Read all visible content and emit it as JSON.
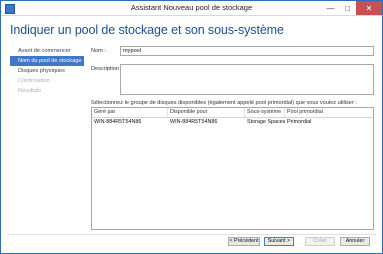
{
  "window": {
    "title": "Assistant Nouveau pool de stockage",
    "minimize_glyph": "—",
    "maximize_glyph": "□",
    "close_glyph": "✕"
  },
  "page": {
    "heading": "Indiquer un pool de stockage et son sous-système"
  },
  "nav": {
    "items": [
      {
        "label": "Avant de commencer",
        "state": "normal"
      },
      {
        "label": "Nom du pool de stockage",
        "state": "active"
      },
      {
        "label": "Disques physiques",
        "state": "normal"
      },
      {
        "label": "Confirmation",
        "state": "disabled"
      },
      {
        "label": "Résultats",
        "state": "disabled"
      }
    ]
  },
  "form": {
    "name_label": "Nom :",
    "name_value": "mypool",
    "description_label": "Description :",
    "description_value": "",
    "pool_prompt": "Sélectionnez le groupe de disques disponibles (également appelé pool primordial) que vous voulez utiliser :"
  },
  "table": {
    "columns": [
      "Géré par",
      "Disponible pour",
      "Sous-système",
      "Pool primordial"
    ],
    "rows": [
      [
        "WIN-884R5T54N86",
        "WIN-884R5T54N86",
        "Storage Spaces",
        "Primordial"
      ]
    ]
  },
  "buttons": {
    "previous": "< Précédent",
    "next": "Suivant >",
    "create": "Créer",
    "cancel": "Annuler"
  },
  "colors": {
    "accent": "#3e79c6",
    "heading": "#1f4f8f",
    "close": "#c75050"
  }
}
